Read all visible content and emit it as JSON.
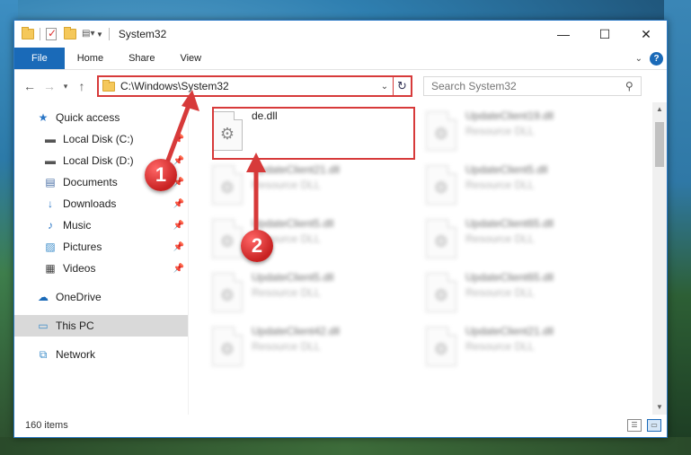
{
  "window": {
    "title": "System32",
    "controls": {
      "minimize": "—",
      "maximize": "☐",
      "close": "✕"
    }
  },
  "ribbon": {
    "tabs": [
      "File",
      "Home",
      "Share",
      "View"
    ],
    "help": "?"
  },
  "navbar": {
    "address": "C:\\Windows\\System32",
    "search_placeholder": "Search System32"
  },
  "sidebar": {
    "items": [
      {
        "label": "Quick access",
        "icon": "star-icon",
        "pinned": false
      },
      {
        "label": "Local Disk (C:)",
        "icon": "disk-icon",
        "pinned": true
      },
      {
        "label": "Local Disk (D:)",
        "icon": "disk-icon",
        "pinned": true
      },
      {
        "label": "Documents",
        "icon": "document-icon",
        "pinned": true
      },
      {
        "label": "Downloads",
        "icon": "download-icon",
        "pinned": true
      },
      {
        "label": "Music",
        "icon": "music-icon",
        "pinned": true
      },
      {
        "label": "Pictures",
        "icon": "pictures-icon",
        "pinned": true
      },
      {
        "label": "Videos",
        "icon": "video-icon",
        "pinned": true
      },
      {
        "label": "OneDrive",
        "icon": "cloud-icon",
        "pinned": false
      },
      {
        "label": "This PC",
        "icon": "pc-icon",
        "pinned": false,
        "selected": true
      },
      {
        "label": "Network",
        "icon": "network-icon",
        "pinned": false
      }
    ]
  },
  "files": [
    {
      "name": "de.dll",
      "type": ""
    },
    {
      "name": "UpdateClient19.dll",
      "type": "Resource DLL"
    },
    {
      "name": "UpdateClient21.dll",
      "type": "Resource DLL"
    },
    {
      "name": "UpdateClient5.dll",
      "type": "Resource DLL"
    },
    {
      "name": "UpdateClient5.dll",
      "type": "Resource DLL"
    },
    {
      "name": "UpdateClient65.dll",
      "type": "Resource DLL"
    },
    {
      "name": "UpdateClient5.dll",
      "type": "Resource DLL"
    },
    {
      "name": "UpdateClient65.dll",
      "type": "Resource DLL"
    },
    {
      "name": "UpdateClient42.dll",
      "type": "Resource DLL"
    },
    {
      "name": "UpdateClient21.dll",
      "type": "Resource DLL"
    }
  ],
  "status": {
    "item_count": "160 items"
  },
  "annotations": {
    "marker1": "1",
    "marker2": "2",
    "color": "#d73a3a"
  }
}
